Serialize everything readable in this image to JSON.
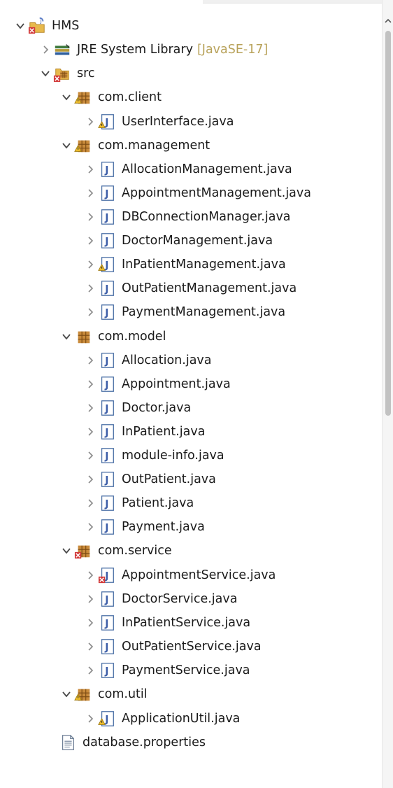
{
  "explorer": {
    "project": {
      "label": "HMS",
      "jre": {
        "label": "JRE System Library",
        "decoration": "[JavaSE-17]"
      },
      "src": {
        "label": "src",
        "packages": [
          {
            "label": "com.client",
            "files": [
              {
                "label": "UserInterface.java"
              }
            ]
          },
          {
            "label": "com.management",
            "files": [
              {
                "label": "AllocationManagement.java"
              },
              {
                "label": "AppointmentManagement.java"
              },
              {
                "label": "DBConnectionManager.java"
              },
              {
                "label": "DoctorManagement.java"
              },
              {
                "label": "InPatientManagement.java"
              },
              {
                "label": "OutPatientManagement.java"
              },
              {
                "label": "PaymentManagement.java"
              }
            ]
          },
          {
            "label": "com.model",
            "files": [
              {
                "label": "Allocation.java"
              },
              {
                "label": "Appointment.java"
              },
              {
                "label": "Doctor.java"
              },
              {
                "label": "InPatient.java"
              },
              {
                "label": "module-info.java"
              },
              {
                "label": "OutPatient.java"
              },
              {
                "label": "Patient.java"
              },
              {
                "label": "Payment.java"
              }
            ]
          },
          {
            "label": "com.service",
            "files": [
              {
                "label": "AppointmentService.java"
              },
              {
                "label": "DoctorService.java"
              },
              {
                "label": "InPatientService.java"
              },
              {
                "label": "OutPatientService.java"
              },
              {
                "label": "PaymentService.java"
              }
            ]
          },
          {
            "label": "com.util",
            "files": [
              {
                "label": "ApplicationUtil.java"
              }
            ]
          }
        ]
      },
      "database_file": {
        "label": "database.properties"
      }
    }
  }
}
